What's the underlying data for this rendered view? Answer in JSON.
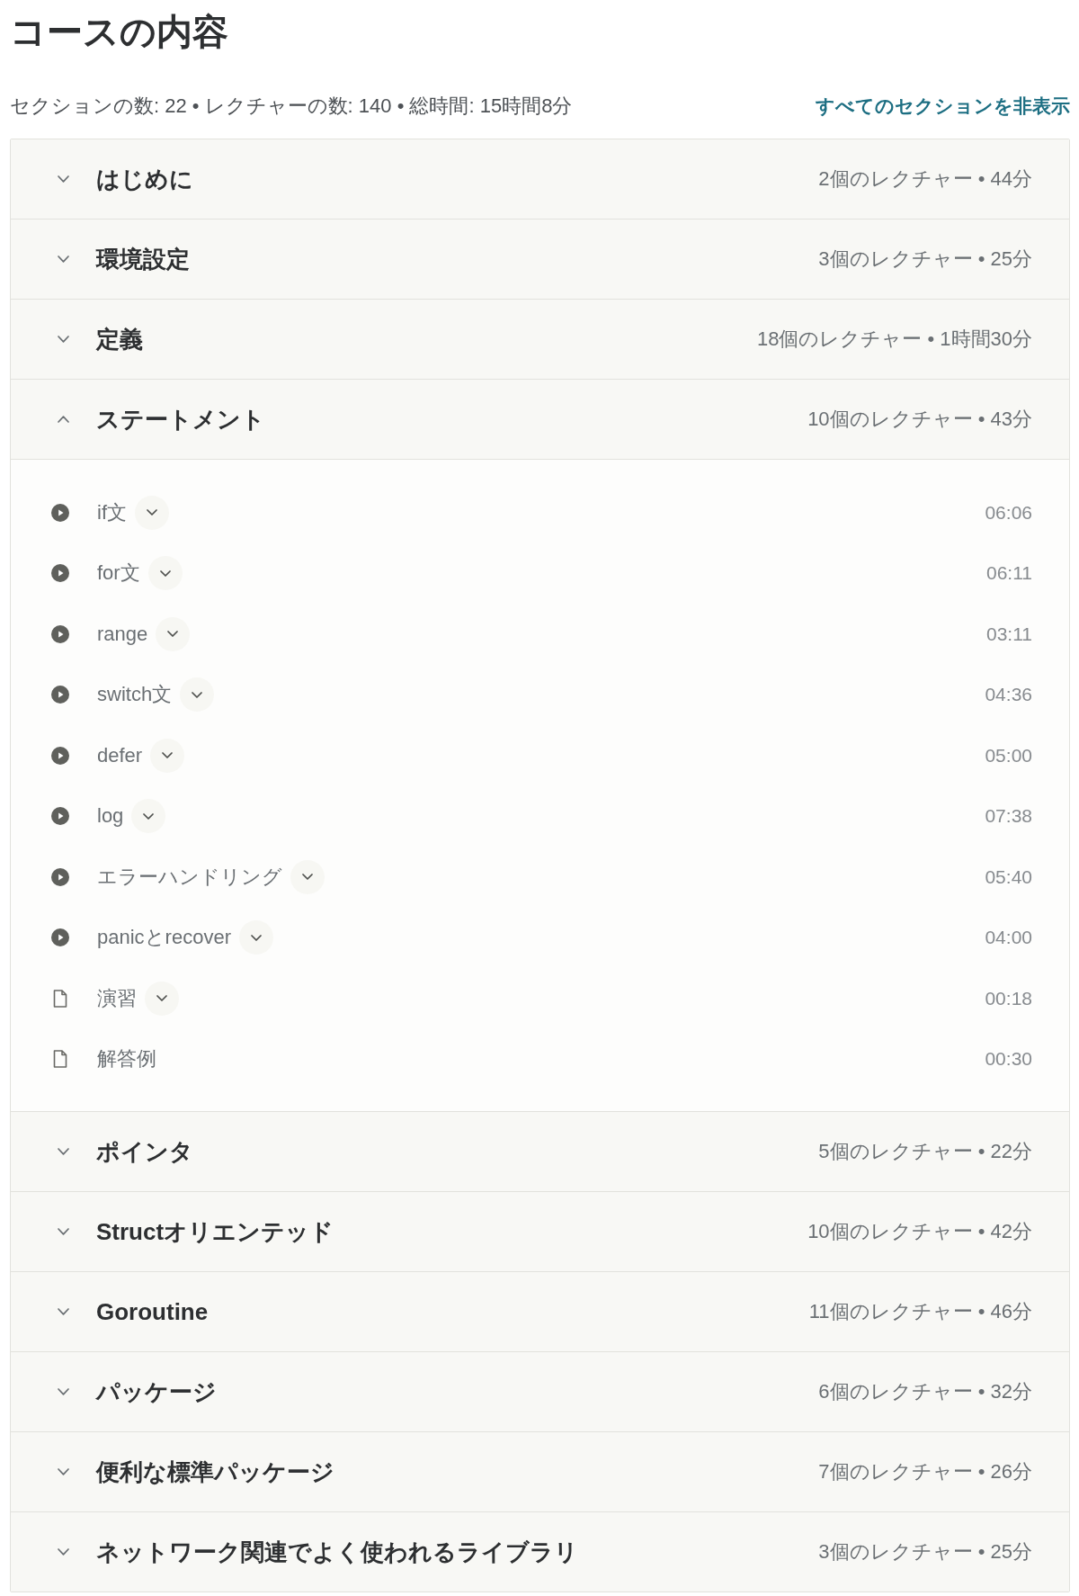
{
  "title": "コースの内容",
  "summary": "セクションの数: 22 • レクチャーの数: 140 • 総時間: 15時間8分",
  "toggle_all_link": "すべてのセクションを非表示",
  "sections": [
    {
      "title": "はじめに",
      "meta": "2個のレクチャー • 44分",
      "expanded": false
    },
    {
      "title": "環境設定",
      "meta": "3個のレクチャー • 25分",
      "expanded": false
    },
    {
      "title": "定義",
      "meta": "18個のレクチャー • 1時間30分",
      "expanded": false
    },
    {
      "title": "ステートメント",
      "meta": "10個のレクチャー • 43分",
      "expanded": true,
      "lectures": [
        {
          "title": "if文",
          "kind": "video",
          "duration": "06:06",
          "expandable": true
        },
        {
          "title": "for文",
          "kind": "video",
          "duration": "06:11",
          "expandable": true
        },
        {
          "title": "range",
          "kind": "video",
          "duration": "03:11",
          "expandable": true
        },
        {
          "title": "switch文",
          "kind": "video",
          "duration": "04:36",
          "expandable": true
        },
        {
          "title": "defer",
          "kind": "video",
          "duration": "05:00",
          "expandable": true
        },
        {
          "title": "log",
          "kind": "video",
          "duration": "07:38",
          "expandable": true
        },
        {
          "title": "エラーハンドリング",
          "kind": "video",
          "duration": "05:40",
          "expandable": true
        },
        {
          "title": "panicとrecover",
          "kind": "video",
          "duration": "04:00",
          "expandable": true
        },
        {
          "title": "演習",
          "kind": "article",
          "duration": "00:18",
          "expandable": true
        },
        {
          "title": "解答例",
          "kind": "article",
          "duration": "00:30",
          "expandable": false
        }
      ]
    },
    {
      "title": "ポインタ",
      "meta": "5個のレクチャー • 22分",
      "expanded": false
    },
    {
      "title": "Structオリエンテッド",
      "meta": "10個のレクチャー • 42分",
      "expanded": false
    },
    {
      "title": "Goroutine",
      "meta": "11個のレクチャー • 46分",
      "expanded": false
    },
    {
      "title": "パッケージ",
      "meta": "6個のレクチャー • 32分",
      "expanded": false
    },
    {
      "title": "便利な標準パッケージ",
      "meta": "7個のレクチャー • 26分",
      "expanded": false
    },
    {
      "title": "ネットワーク関連でよく使われるライブラリ",
      "meta": "3個のレクチャー • 25分",
      "expanded": false
    }
  ]
}
